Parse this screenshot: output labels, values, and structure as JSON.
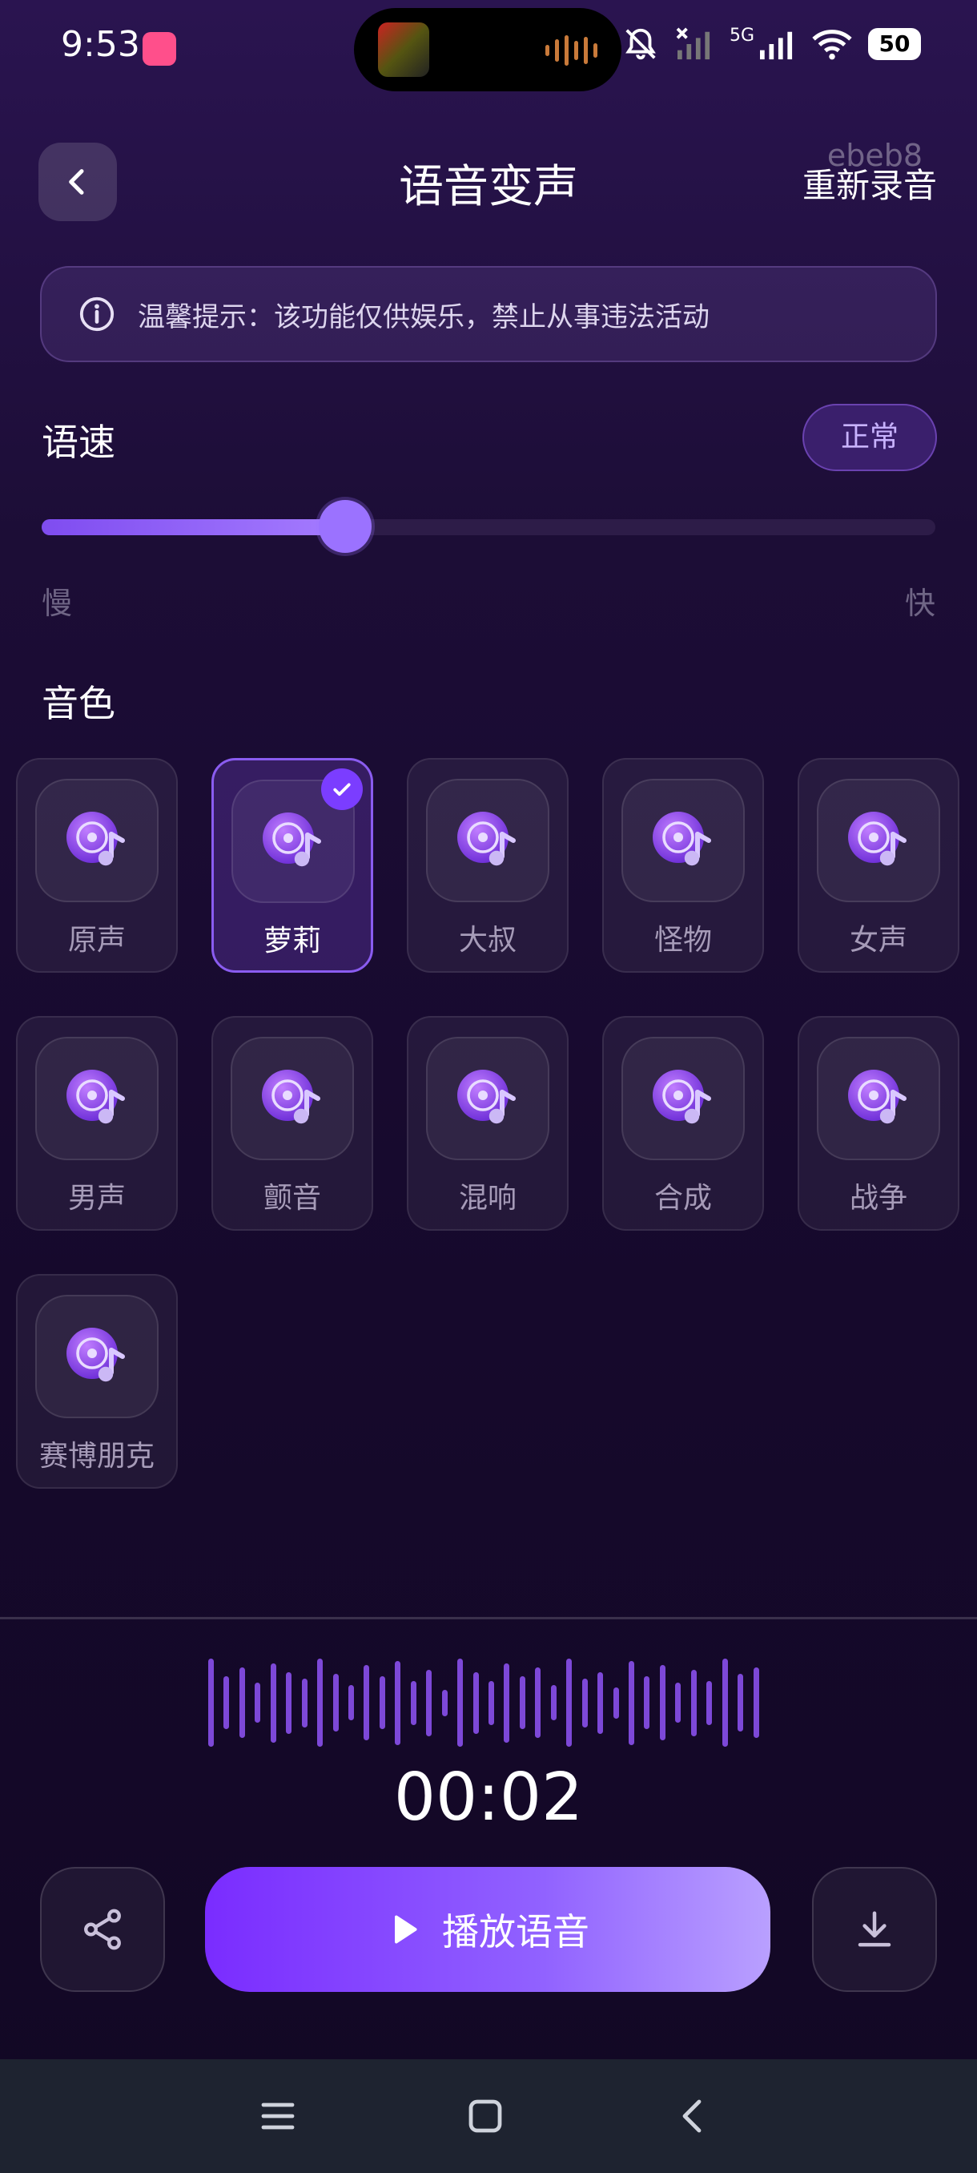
{
  "status_bar": {
    "time": "9:53",
    "network": "5G",
    "battery": "50"
  },
  "header": {
    "title": "语音变声",
    "watermark": "ebeb8",
    "rerecord_label": "重新录音"
  },
  "notice": {
    "text": "温馨提示：该功能仅供娱乐，禁止从事违法活动"
  },
  "speed": {
    "label": "语速",
    "value_label": "正常",
    "slow_label": "慢",
    "fast_label": "快",
    "level": 0.34
  },
  "timbre": {
    "label": "音色",
    "selected_index": 1,
    "items": [
      {
        "label": "原声"
      },
      {
        "label": "萝莉"
      },
      {
        "label": "大叔"
      },
      {
        "label": "怪物"
      },
      {
        "label": "女声"
      },
      {
        "label": "男声"
      },
      {
        "label": "颤音"
      },
      {
        "label": "混响"
      },
      {
        "label": "合成"
      },
      {
        "label": "战争"
      },
      {
        "label": "赛博朋克"
      }
    ]
  },
  "player": {
    "duration": "00:02",
    "play_label": "播放语音"
  },
  "colors": {
    "accent": "#7b3dff",
    "accent_light": "#b9a0ff",
    "waveform": "#7d48d8"
  }
}
